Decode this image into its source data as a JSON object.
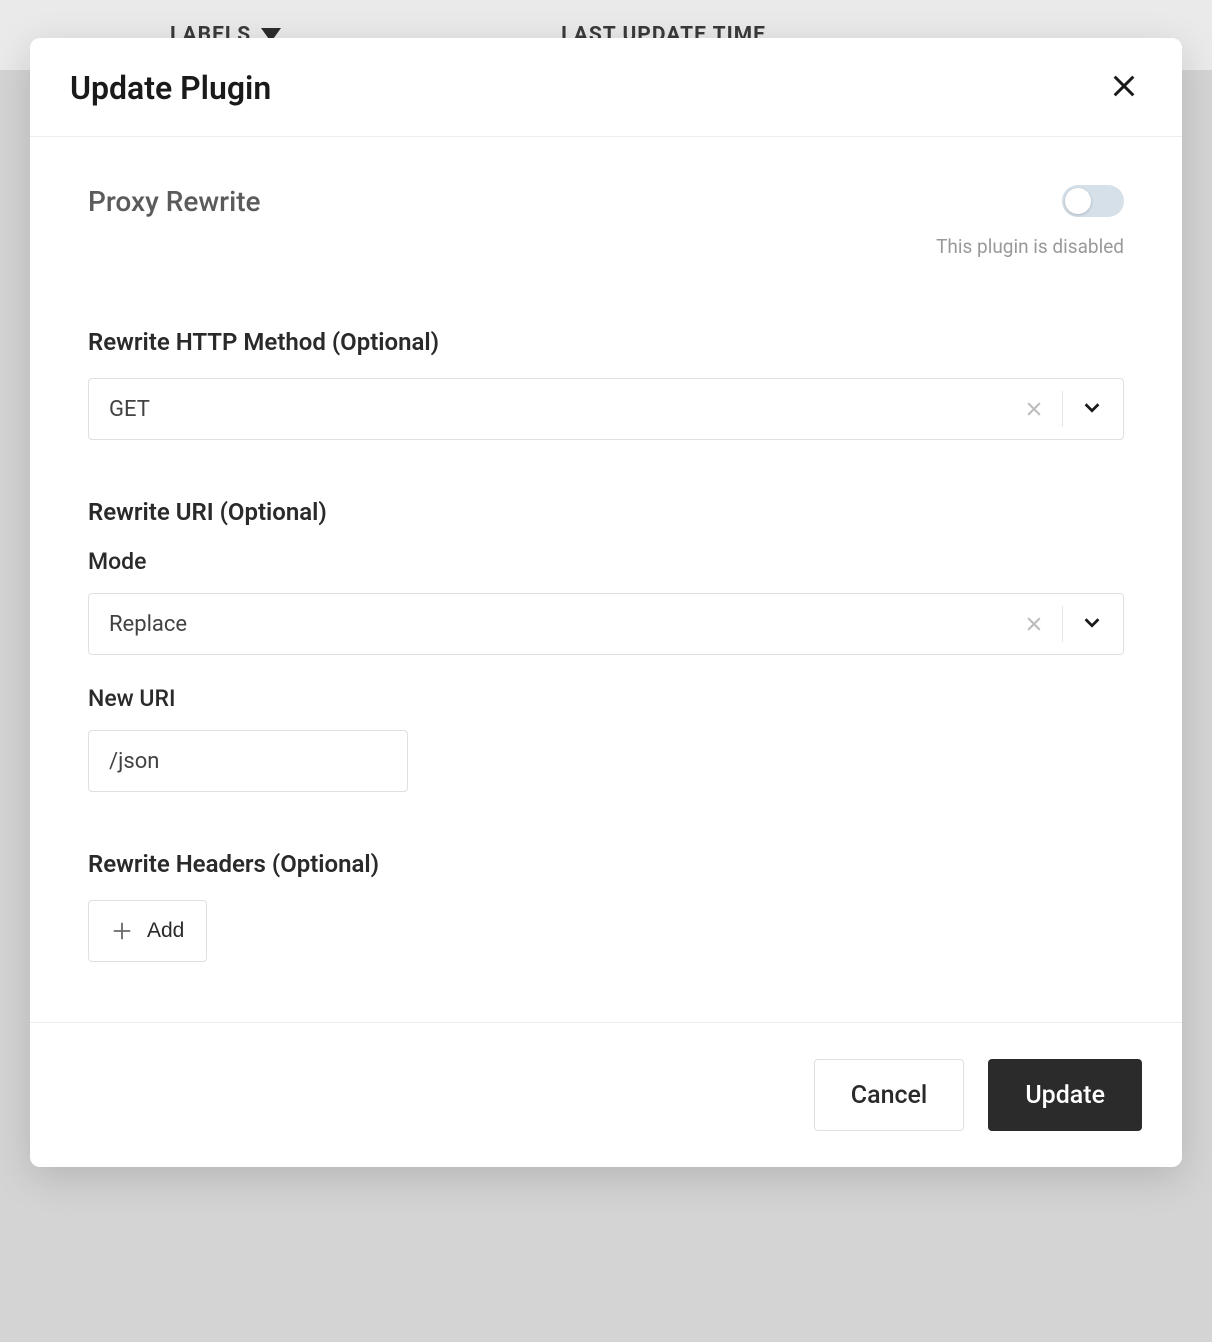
{
  "background": {
    "col1": "LABELS",
    "col2": "LAST UPDATE TIME"
  },
  "modal": {
    "title": "Update Plugin",
    "plugin_name": "Proxy Rewrite",
    "toggle": {
      "enabled": false,
      "status_text": "This plugin is disabled"
    },
    "sections": {
      "http_method": {
        "label": "Rewrite HTTP Method (Optional)",
        "value": "GET"
      },
      "uri": {
        "label": "Rewrite URI (Optional)",
        "mode_label": "Mode",
        "mode_value": "Replace",
        "new_uri_label": "New URI",
        "new_uri_value": "/json"
      },
      "headers": {
        "label": "Rewrite Headers (Optional)",
        "add_button": "Add"
      }
    },
    "footer": {
      "cancel": "Cancel",
      "update": "Update"
    }
  }
}
